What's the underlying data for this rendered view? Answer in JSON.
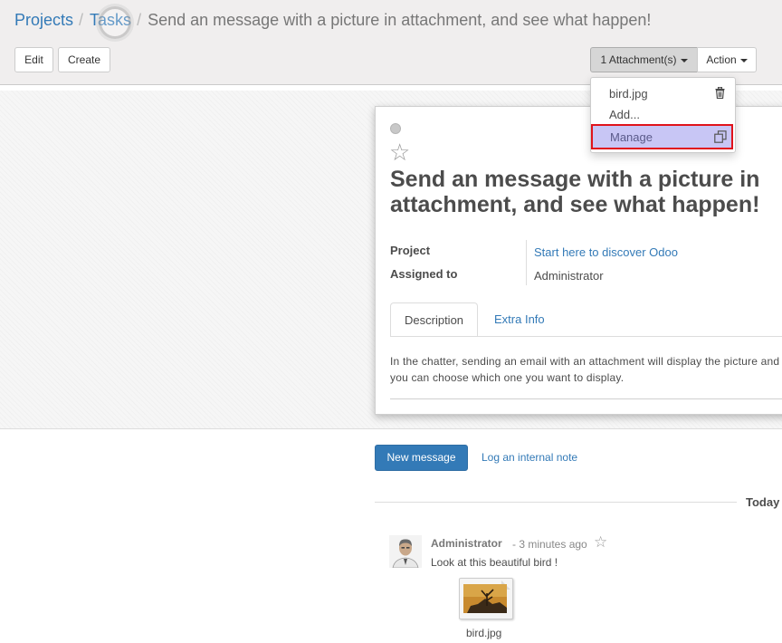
{
  "breadcrumb": {
    "projects": "Projects",
    "separator1": "/",
    "tasks": "Tasks",
    "separator2": "/",
    "current": "Send an message with a picture in attachment, and see what happen!"
  },
  "toolbar": {
    "edit_label": "Edit",
    "create_label": "Create",
    "attachments_label": "1 Attachment(s)",
    "action_label": "Action"
  },
  "attachment_menu": {
    "file_name": "bird.jpg",
    "add_label": "Add...",
    "manage_label": "Manage"
  },
  "task": {
    "title": "Send an message with a picture in attachment, and see what happen!",
    "fields": {
      "project_label": "Project",
      "project_value": "Start here to discover Odoo",
      "assigned_label": "Assigned to",
      "assigned_value": "Administrator"
    },
    "tabs": [
      "Description",
      "Extra Info"
    ],
    "description": "In the chatter, sending an email with an attachment will display the picture and you can choose which one you want to display."
  },
  "chatter": {
    "new_message_label": "New message",
    "log_note_label": "Log an internal note",
    "day_label": "Today",
    "message": {
      "author": "Administrator",
      "time": "- 3 minutes ago",
      "body": "Look at this beautiful bird !",
      "attachment_name": "bird.jpg"
    }
  },
  "colors": {
    "link": "#337ab7",
    "primary_button": "#337ab7",
    "highlight_border": "#e0131b",
    "menu_active_bg": "#c8c6f5"
  },
  "icons": [
    "star-icon",
    "trash-icon",
    "copy-icon",
    "caret-down-icon",
    "avatar"
  ]
}
